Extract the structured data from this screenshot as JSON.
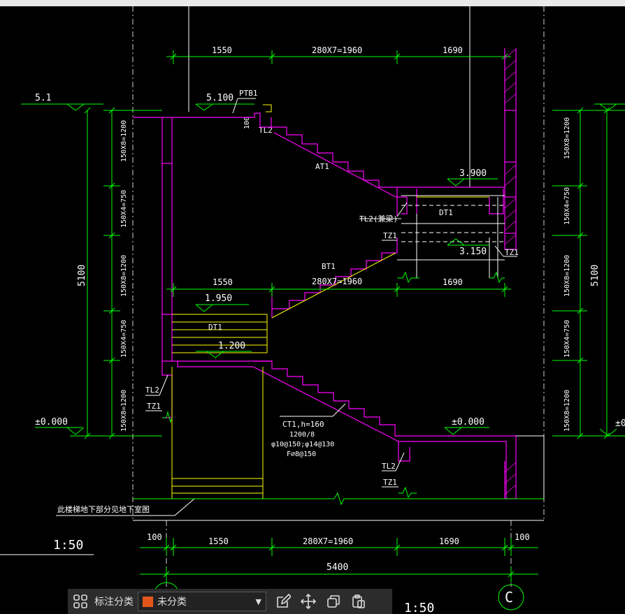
{
  "colors": {
    "background": "#000000",
    "line_green": "#00ff00",
    "line_magenta": "#ff00ff",
    "line_yellow": "#ffff00",
    "line_white": "#ffffff",
    "toolbar_bg": "#2c2c2c",
    "layer_swatch": "#e3561b"
  },
  "drawing": {
    "dims_top": {
      "left": "1550",
      "middle": "280X7=1960",
      "right": "1690"
    },
    "dims_mid": {
      "left": "1550",
      "middle": "280X7=1960",
      "right": "1690"
    },
    "dims_bottom": {
      "left_end": "100",
      "left": "1550",
      "middle": "280X7=1960",
      "right": "1690",
      "right_end": "100",
      "total": "5400"
    },
    "elevations": {
      "top_left": "5.1",
      "landing_top": "5.100",
      "landing_right_upper": "3.900",
      "landing_right_lower": "3.150",
      "landing_left_upper": "1.950",
      "landing_left_lower": "1.200",
      "ground_left": "±0.000",
      "ground_right": "±0.000",
      "ground_far_right": "±0"
    },
    "left_vertical_dims": [
      "150X8=1200",
      "150X4=750",
      "150X8=1200",
      "150X4=750",
      "150X8=1200"
    ],
    "left_total": "5100",
    "right_vertical_dims": [
      "150X8=1200",
      "150X4=750",
      "150X8=1200",
      "150X4=750",
      "150X8=1200"
    ],
    "right_total": "5100",
    "labels": {
      "ptb1": "PTB1",
      "thk_100": "100",
      "tl2_top": "TL2",
      "at1": "AT1",
      "dt1_right": "DT1",
      "tl2_right_upper": "TL2(兼梁)",
      "tz1_right_upper": "TZ1",
      "tz1_right_col": "TZ1",
      "bt1": "BT1",
      "dt1_left": "DT1",
      "tl2_left": "TL2",
      "tz1_left": "TZ1",
      "ct1_line1": "CT1,h=160",
      "ct1_line2": "1200/8",
      "ct1_line3": "φ10@150;φ14@130",
      "ct1_line4": "F⌀8@150",
      "tl2_bottom": "TL2",
      "tz1_bottom": "TZ1",
      "basement_note": "此楼梯地下部分见地下室图",
      "scale_left": "1:50",
      "scale_toolbar": "1:50",
      "axis_c": "C"
    }
  },
  "toolbar": {
    "category_label": "标注分类",
    "layer_value": "未分类"
  }
}
